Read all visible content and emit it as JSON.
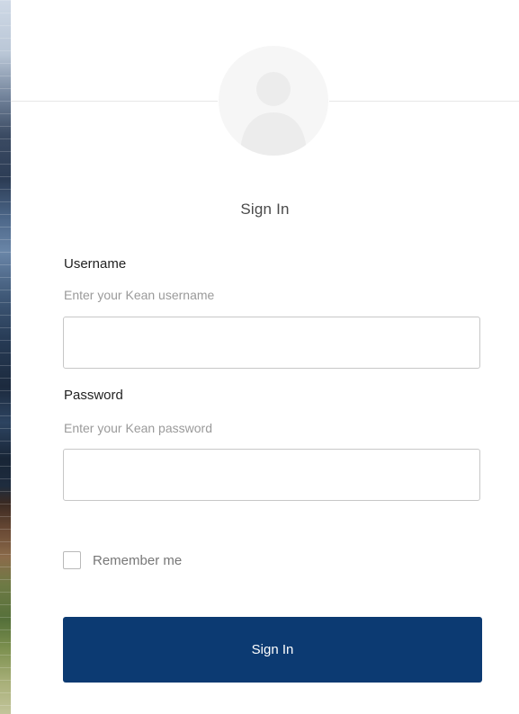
{
  "signin": {
    "title": "Sign In",
    "username": {
      "label": "Username",
      "hint": "Enter your Kean username",
      "value": "",
      "placeholder": ""
    },
    "password": {
      "label": "Password",
      "hint": "Enter your Kean password",
      "value": "",
      "placeholder": ""
    },
    "remember_label": "Remember me",
    "remember_checked": false,
    "submit_label": "Sign In"
  },
  "icons": {
    "avatar": "user-silhouette-icon"
  },
  "colors": {
    "primary_button": "#0c3a72",
    "avatar_bg": "#f6f6f6",
    "avatar_silhouette": "#ececec",
    "input_border": "#c7c7c7",
    "hint_text": "#9a9a9a"
  }
}
